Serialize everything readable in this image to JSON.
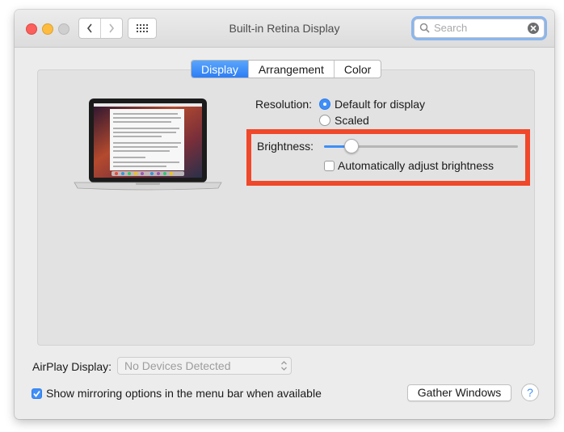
{
  "window": {
    "title": "Built-in Retina Display"
  },
  "search": {
    "placeholder": "Search"
  },
  "tabs": [
    {
      "label": "Display",
      "active": true
    },
    {
      "label": "Arrangement",
      "active": false
    },
    {
      "label": "Color",
      "active": false
    }
  ],
  "resolution": {
    "label": "Resolution:",
    "options": [
      {
        "label": "Default for display",
        "selected": true
      },
      {
        "label": "Scaled",
        "selected": false
      }
    ]
  },
  "brightness": {
    "label": "Brightness:",
    "level": 0.14,
    "auto_label": "Automatically adjust brightness",
    "auto_checked": false
  },
  "airplay": {
    "label": "AirPlay Display:",
    "value": "No Devices Detected"
  },
  "mirroring": {
    "label": "Show mirroring options in the menu bar when available",
    "checked": true
  },
  "gather_label": "Gather Windows",
  "help_label": "?",
  "colors": {
    "accent": "#3f8ff8",
    "highlight": "#f0482a"
  },
  "icons": [
    "chevron-left-icon",
    "chevron-right-icon",
    "grid-icon",
    "search-icon",
    "clear-icon",
    "laptop-icon",
    "updown-arrows-icon",
    "checkmark-icon"
  ]
}
